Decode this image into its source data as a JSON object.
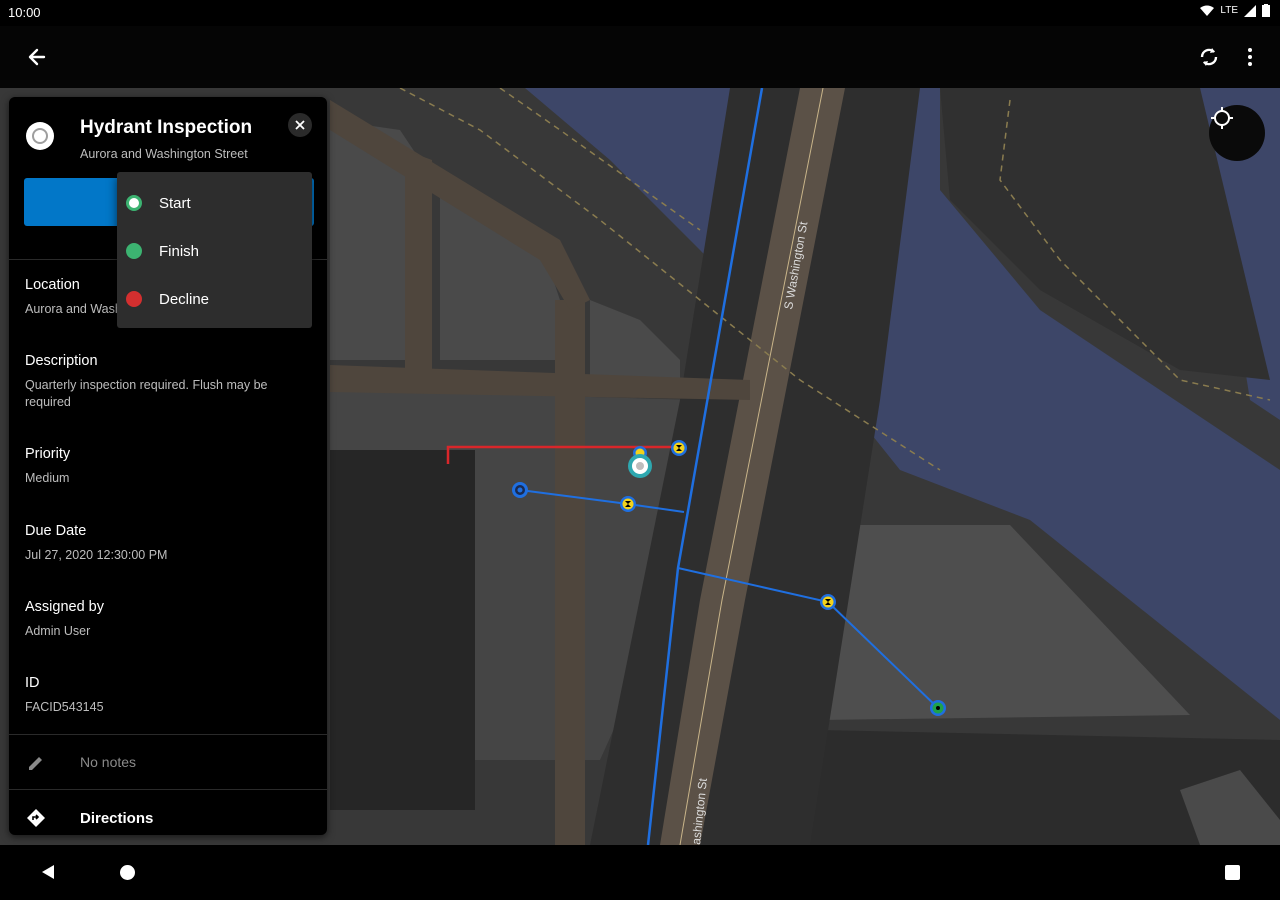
{
  "status_bar": {
    "time": "10:00",
    "network": "LTE"
  },
  "app_bar": {
    "back_icon": "arrow-back-icon",
    "sync_icon": "sync-icon",
    "more_icon": "more-vert-icon"
  },
  "map": {
    "street_labels": [
      "S Washington St",
      "S Washington St"
    ],
    "street_label_visible": [
      "S Washington St",
      "ashington St"
    ],
    "colors": {
      "water": "#3d4668",
      "land": "#3a3a3a",
      "block": "#4a4a4a",
      "road": "#5b5147",
      "pipe": "#1f6fe0",
      "lateral": "#d9262a"
    }
  },
  "panel": {
    "title": "Hydrant Inspection",
    "subtitle": "Aurora and Washington Street",
    "fields": [
      {
        "label": "Location",
        "value": "Aurora and Washington Street"
      },
      {
        "label": "Description",
        "value": "Quarterly inspection required. Flush may be required"
      },
      {
        "label": "Priority",
        "value": "Medium"
      },
      {
        "label": "Due Date",
        "value": "Jul 27, 2020 12:30:00 PM"
      },
      {
        "label": "Assigned by",
        "value": "Admin User"
      },
      {
        "label": "ID",
        "value": "FACID543145"
      }
    ],
    "notes": "No notes",
    "directions": "Directions"
  },
  "status_menu": {
    "items": [
      {
        "label": "Start",
        "color": "#3cb371"
      },
      {
        "label": "Finish",
        "color": "#3cb371"
      },
      {
        "label": "Decline",
        "color": "#d32f2f"
      }
    ]
  }
}
